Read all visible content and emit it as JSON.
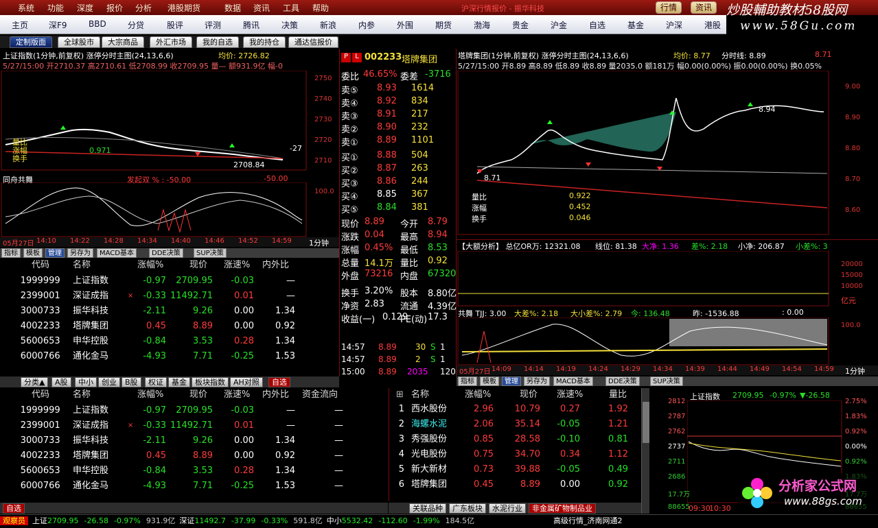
{
  "menu": [
    "系统",
    "功能",
    "深度",
    "报价",
    "分析",
    "港股期货",
    "数据",
    "资讯",
    "工具",
    "帮助"
  ],
  "menu_title": "沪深行情报价 - 振华科技",
  "top_buttons": [
    "行情",
    "资讯"
  ],
  "brand": {
    "line1": "炒股輔助教材58股网",
    "line2": "www.58Gu.com"
  },
  "nav": [
    "主页",
    "深F9",
    "BBD",
    "分贷",
    "股评",
    "评测",
    "腾讯",
    "决策",
    "新浪",
    "内参",
    "外围",
    "期货",
    "渤海",
    "贵金",
    "沪金",
    "自选",
    "基金",
    "沪深",
    "港股"
  ],
  "panel_tabs": [
    "定制版面",
    "全球股市",
    "大宗商品",
    "外汇市场",
    "我的自选",
    "我的持仓",
    "通达信报价"
  ],
  "index_chart": {
    "title": "上证指数(1分钟,前复权) 涨停分时主图(24,13,6,6)",
    "avg": "均价: 2726.82",
    "line2": "5/27/15:00 开2710.37 高2710.61 低2708.99 收2709.95 量— 额931.9亿 幅-0",
    "labels": [
      "量比",
      "涨幅",
      "换手"
    ],
    "low_label": "2708.84",
    "mark": "-27",
    "mark2": "0.971",
    "yticks": [
      "2750",
      "2740",
      "2730",
      "2720",
      "2710"
    ]
  },
  "osc1": {
    "title": "同舟共舞",
    "ind": "发起双 % : -50.00",
    "ind2": "-50.00",
    "ytick": "100.0",
    "dates": [
      "05月27日",
      "14:10",
      "14:22",
      "14:28",
      "14:34",
      "14:40",
      "14:46",
      "14:52",
      "14:59"
    ],
    "period": "1分钟"
  },
  "tools1": [
    "指标",
    "模板",
    "管理",
    "另存为",
    "MACD基本",
    "DDE决策",
    "SUP决策"
  ],
  "table_headers": [
    "代码",
    "名称",
    "涨幅%",
    "现价",
    "涨速%",
    "内外比"
  ],
  "table_headers2": [
    "代码",
    "名称",
    "涨幅%",
    "现价",
    "涨速%",
    "内外比",
    "资金流向"
  ],
  "stocks": [
    {
      "no": "1",
      "code": "999999",
      "name": "上证指数",
      "chg": "-0.97",
      "price": "2709.95",
      "spd": "-0.03",
      "ratio": "—",
      "flow": "—",
      "mark": ""
    },
    {
      "no": "2",
      "code": "399001",
      "name": "深证成指",
      "chg": "-0.33",
      "price": "11492.71",
      "spd": "0.01",
      "ratio": "—",
      "flow": "—",
      "mark": "×"
    },
    {
      "no": "3",
      "code": "000733",
      "name": "振华科技",
      "chg": "-2.11",
      "price": "9.26",
      "spd": "0.00",
      "ratio": "1.34",
      "flow": "—",
      "mark": ""
    },
    {
      "no": "4",
      "code": "002233",
      "name": "塔牌集团",
      "chg": "0.45",
      "price": "8.89",
      "spd": "0.00",
      "ratio": "0.92",
      "flow": "—",
      "mark": ""
    },
    {
      "no": "5",
      "code": "600653",
      "name": "申华控股",
      "chg": "-0.84",
      "price": "3.53",
      "spd": "0.28",
      "ratio": "1.34",
      "flow": "—",
      "mark": ""
    },
    {
      "no": "6",
      "code": "000766",
      "name": "通化金马",
      "chg": "-4.93",
      "price": "7.71",
      "spd": "-0.25",
      "ratio": "1.53",
      "flow": "—",
      "mark": ""
    }
  ],
  "cat_tabs": [
    "分类▲",
    "A股",
    "中小",
    "创业",
    "B股",
    "权证",
    "基金",
    "板块指数",
    "AH对照",
    "自选"
  ],
  "quote": {
    "code": "002233",
    "name": "塔牌集团",
    "wei": [
      {
        "l": "委比",
        "v": "46.65%"
      },
      {
        "l": "委差",
        "v": "-3716"
      }
    ],
    "sells": [
      {
        "l": "卖⑤",
        "p": "8.93",
        "v": "1614"
      },
      {
        "l": "卖④",
        "p": "8.92",
        "v": "834"
      },
      {
        "l": "卖③",
        "p": "8.91",
        "v": "217"
      },
      {
        "l": "卖②",
        "p": "8.90",
        "v": "232"
      },
      {
        "l": "卖①",
        "p": "8.89",
        "v": "1101"
      }
    ],
    "buys": [
      {
        "l": "买①",
        "p": "8.88",
        "v": "504"
      },
      {
        "l": "买②",
        "p": "8.87",
        "v": "263"
      },
      {
        "l": "买③",
        "p": "8.86",
        "v": "244"
      },
      {
        "l": "买④",
        "p": "8.85",
        "v": "367"
      },
      {
        "l": "买⑤",
        "p": "8.84",
        "v": "381"
      }
    ],
    "stats": [
      [
        "现价",
        "8.89",
        "今开",
        "8.79"
      ],
      [
        "涨跌",
        "0.04",
        "最高",
        "8.94"
      ],
      [
        "涨幅",
        "0.45%",
        "最低",
        "8.53"
      ],
      [
        "总量",
        "14.1万",
        "量比",
        "0.92"
      ],
      [
        "外盘",
        "73216",
        "内盘",
        "67320"
      ],
      [
        "换手",
        "3.20%",
        "股本",
        "8.80亿"
      ],
      [
        "净资",
        "2.83",
        "流通",
        "4.39亿"
      ],
      [
        "收益(一)",
        "0.129",
        "PE(动)",
        "17.3"
      ]
    ],
    "ticks": [
      [
        "14:57",
        "8.89",
        "30",
        "S",
        "1"
      ],
      [
        "14:57",
        "8.89",
        "2",
        "S",
        "1"
      ],
      [
        "15:00",
        "8.89",
        "2035",
        "",
        "120"
      ]
    ]
  },
  "stock_chart": {
    "title": "塔牌集团(1分钟,前复权) 涨停分时主图(24,13,6,6)",
    "avg": "均价: 8.77",
    "line_label": "分时线: 8.89",
    "right_val": "8.71",
    "line2": "5/27/15:00 开8.89 高8.89 低8.89 收8.89 量2035.0 额181万 幅0.00(0.00%) 振0.00(0.00%) 换0.05%",
    "hi": "8.94",
    "lo": "8.71",
    "yticks": [
      "9.00",
      "8.90",
      "8.80",
      "8.70",
      "8.60"
    ],
    "labels": [
      "量比",
      "涨幅",
      "换手"
    ],
    "vals": [
      "0.922",
      "0.452",
      "0.046"
    ]
  },
  "bigorder": {
    "title": "【大额分析】 总亿OR万: 12321.08",
    "a": "线位: 81.38",
    "b": "大净: 1.36",
    "c": "差%: 2.18",
    "d": "小净: 206.87",
    "e": "小差%: 3",
    "yticks": [
      "20000",
      "15000",
      "10000"
    ],
    "unit": "亿元"
  },
  "osc2": {
    "title": "共舞 TJJ: 3.00",
    "a": "大差%: 2.18",
    "b": "大小差%: 2.79",
    "c": "今: 136.48",
    "d": "昨: -1536.88",
    "e": ": 0.00",
    "ytick": "100.0",
    "dates": [
      "05月27日",
      "14:09",
      "14:14",
      "14:19",
      "14:24",
      "14:29",
      "14:34",
      "14:39",
      "14:44",
      "14:49",
      "14:54",
      "14:59"
    ],
    "period": "1分钟"
  },
  "tools2": [
    "指标",
    "模板",
    "管理",
    "另存为",
    "MACD基本",
    "DDE决策",
    "SUP决策"
  ],
  "list2_headers": [
    "名称",
    "涨幅%",
    "现价",
    "涨速%",
    "量比"
  ],
  "list2": [
    {
      "no": "1",
      "name": "西水股份",
      "chg": "2.96",
      "price": "10.79",
      "spd": "0.27",
      "vr": "1.92"
    },
    {
      "no": "2",
      "name": "海螺水泥",
      "chg": "2.06",
      "price": "35.14",
      "spd": "-0.05",
      "vr": "1.21"
    },
    {
      "no": "3",
      "name": "秀强股份",
      "chg": "0.85",
      "price": "28.58",
      "spd": "-0.10",
      "vr": "0.81"
    },
    {
      "no": "4",
      "name": "光电股份",
      "chg": "0.75",
      "price": "34.70",
      "spd": "0.34",
      "vr": "1.12"
    },
    {
      "no": "5",
      "name": "新大新材",
      "chg": "0.73",
      "price": "39.88",
      "spd": "-0.05",
      "vr": "0.49"
    },
    {
      "no": "6",
      "name": "塔牌集团",
      "chg": "0.45",
      "price": "8.89",
      "spd": "0.00",
      "vr": "0.92"
    }
  ],
  "list2_tabs": [
    "关联品种",
    "广东板块",
    "水泥行业",
    "非金属矿物制品业"
  ],
  "mini": {
    "title": "上证指数",
    "price": "2709.95",
    "chg": "-0.97%",
    "diff": "▼-26.58",
    "yl": [
      "2812",
      "2787",
      "2762",
      "2737",
      "2711",
      "2686",
      "17.7万",
      "88655"
    ],
    "yr": [
      "2.75%",
      "1.83%",
      "0.92%",
      "0.00%",
      "0.92%",
      "1.83%",
      "17.7万",
      "88655"
    ],
    "times": [
      "09:30",
      "10:30"
    ]
  },
  "bottom_tab": "自选",
  "status": {
    "guest": "观察员",
    "items": [
      {
        "n": "上证",
        "v": "2709.95",
        "d": "-26.58",
        "p": "-0.97%",
        "a": "931.9亿"
      },
      {
        "n": "深证",
        "v": "11492.7",
        "d": "-37.99",
        "p": "-0.33%",
        "a": "591.8亿"
      },
      {
        "n": "中小",
        "v": "5532.42",
        "d": "-112.60",
        "p": "-1.99%",
        "a": "184.5亿"
      }
    ],
    "right": "高级行情_济南网通2"
  },
  "logo2": {
    "title": "分析家公式网",
    "url": "www.88gs.com"
  },
  "colors": {
    "up": "#ff3b3b",
    "down": "#28e028",
    "accent": "#a00000"
  }
}
